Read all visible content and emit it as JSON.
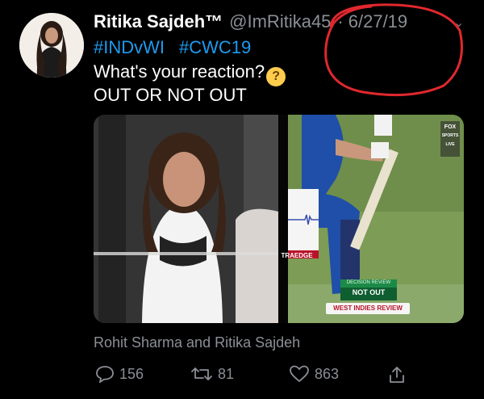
{
  "tweet": {
    "name": "Ritika Sajdeh™",
    "handle": "@ImRitika45",
    "date": "6/27/19",
    "hashtags": [
      "#INDvWI",
      "#CWC19"
    ],
    "text_line1": "What's your reaction?",
    "text_line2": "OUT OR NOT OUT",
    "tagged": "Rohit Sharma and Ritika Sajdeh",
    "replies": "156",
    "retweets": "81",
    "likes": "863"
  },
  "media": {
    "snicko_label": "TRAEDGE",
    "decision_title": "DECISION REVIEW",
    "decision_value": "NOT OUT",
    "review_label": "WEST INDIES REVIEW",
    "broadcaster_line1": "FOX",
    "broadcaster_line2": "SPORTS",
    "broadcaster_line3": "LIVE"
  },
  "colors": {
    "hashtag": "#1d9bf0",
    "annotation": "#e0282e",
    "muted": "#8b8f95"
  }
}
